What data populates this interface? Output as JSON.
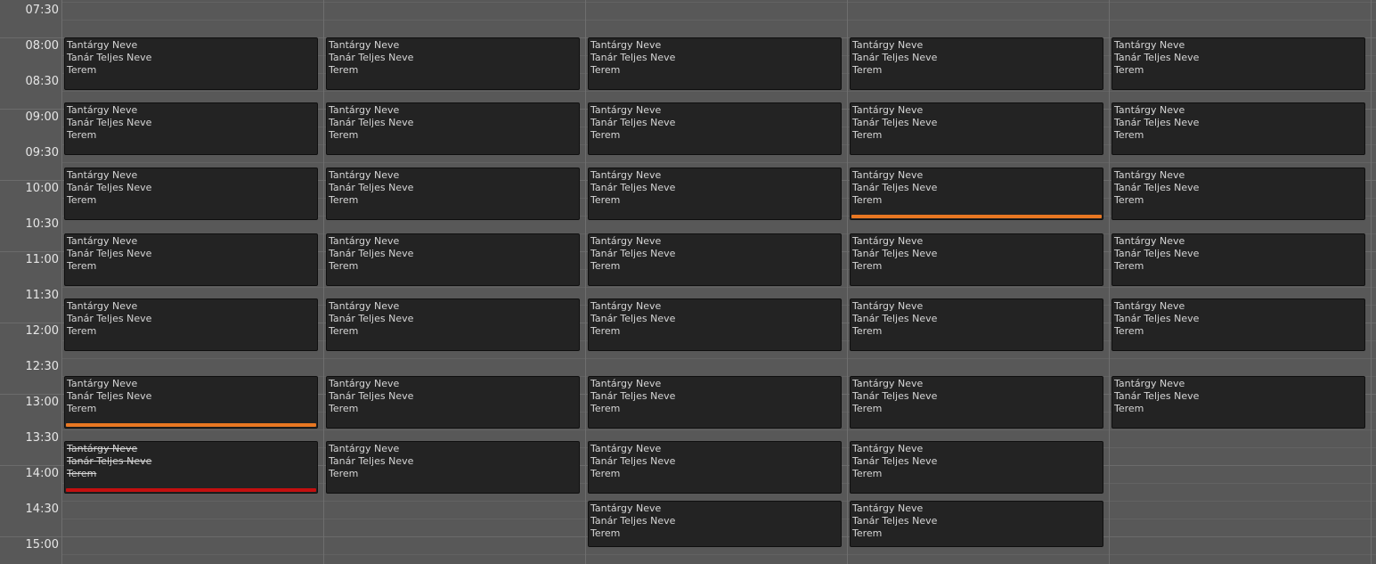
{
  "colors": {
    "background": "#585858",
    "lesson_background": "#232323",
    "lesson_text": "#d6d6d6",
    "status_changed": "#e87722",
    "status_cancelled": "#c40f0f"
  },
  "time_labels": [
    "07:30",
    "08:00",
    "08:30",
    "09:00",
    "09:30",
    "10:00",
    "10:30",
    "11:00",
    "11:30",
    "12:00",
    "12:30",
    "13:00",
    "13:30",
    "14:00",
    "14:30",
    "15:00"
  ],
  "days": [
    {
      "lessons": [
        {
          "subject": "Tantárgy Neve",
          "teacher": "Tanár Teljes Neve",
          "room": "Terem",
          "status": "normal"
        },
        {
          "subject": "Tantárgy Neve",
          "teacher": "Tanár Teljes Neve",
          "room": "Terem",
          "status": "normal"
        },
        {
          "subject": "Tantárgy Neve",
          "teacher": "Tanár Teljes Neve",
          "room": "Terem",
          "status": "normal"
        },
        {
          "subject": "Tantárgy Neve",
          "teacher": "Tanár Teljes Neve",
          "room": "Terem",
          "status": "normal"
        },
        {
          "subject": "Tantárgy Neve",
          "teacher": "Tanár Teljes Neve",
          "room": "Terem",
          "status": "normal"
        },
        {
          "subject": "Tantárgy Neve",
          "teacher": "Tanár Teljes Neve",
          "room": "Terem",
          "status": "changed"
        },
        {
          "subject": "Tantárgy Neve",
          "teacher": "Tanár Teljes Neve",
          "room": "Terem",
          "status": "cancelled"
        }
      ]
    },
    {
      "lessons": [
        {
          "subject": "Tantárgy Neve",
          "teacher": "Tanár Teljes Neve",
          "room": "Terem",
          "status": "normal"
        },
        {
          "subject": "Tantárgy Neve",
          "teacher": "Tanár Teljes Neve",
          "room": "Terem",
          "status": "normal"
        },
        {
          "subject": "Tantárgy Neve",
          "teacher": "Tanár Teljes Neve",
          "room": "Terem",
          "status": "normal"
        },
        {
          "subject": "Tantárgy Neve",
          "teacher": "Tanár Teljes Neve",
          "room": "Terem",
          "status": "normal"
        },
        {
          "subject": "Tantárgy Neve",
          "teacher": "Tanár Teljes Neve",
          "room": "Terem",
          "status": "normal"
        },
        {
          "subject": "Tantárgy Neve",
          "teacher": "Tanár Teljes Neve",
          "room": "Terem",
          "status": "normal"
        },
        {
          "subject": "Tantárgy Neve",
          "teacher": "Tanár Teljes Neve",
          "room": "Terem",
          "status": "normal"
        }
      ]
    },
    {
      "lessons": [
        {
          "subject": "Tantárgy Neve",
          "teacher": "Tanár Teljes Neve",
          "room": "Terem",
          "status": "normal"
        },
        {
          "subject": "Tantárgy Neve",
          "teacher": "Tanár Teljes Neve",
          "room": "Terem",
          "status": "normal"
        },
        {
          "subject": "Tantárgy Neve",
          "teacher": "Tanár Teljes Neve",
          "room": "Terem",
          "status": "normal"
        },
        {
          "subject": "Tantárgy Neve",
          "teacher": "Tanár Teljes Neve",
          "room": "Terem",
          "status": "normal"
        },
        {
          "subject": "Tantárgy Neve",
          "teacher": "Tanár Teljes Neve",
          "room": "Terem",
          "status": "normal"
        },
        {
          "subject": "Tantárgy Neve",
          "teacher": "Tanár Teljes Neve",
          "room": "Terem",
          "status": "normal"
        },
        {
          "subject": "Tantárgy Neve",
          "teacher": "Tanár Teljes Neve",
          "room": "Terem",
          "status": "normal"
        },
        {
          "subject": "Tantárgy Neve",
          "teacher": "Tanár Teljes Neve",
          "room": "Terem",
          "status": "normal"
        }
      ]
    },
    {
      "lessons": [
        {
          "subject": "Tantárgy Neve",
          "teacher": "Tanár Teljes Neve",
          "room": "Terem",
          "status": "normal"
        },
        {
          "subject": "Tantárgy Neve",
          "teacher": "Tanár Teljes Neve",
          "room": "Terem",
          "status": "normal"
        },
        {
          "subject": "Tantárgy Neve",
          "teacher": "Tanár Teljes Neve",
          "room": "Terem",
          "status": "changed"
        },
        {
          "subject": "Tantárgy Neve",
          "teacher": "Tanár Teljes Neve",
          "room": "Terem",
          "status": "normal"
        },
        {
          "subject": "Tantárgy Neve",
          "teacher": "Tanár Teljes Neve",
          "room": "Terem",
          "status": "normal"
        },
        {
          "subject": "Tantárgy Neve",
          "teacher": "Tanár Teljes Neve",
          "room": "Terem",
          "status": "normal"
        },
        {
          "subject": "Tantárgy Neve",
          "teacher": "Tanár Teljes Neve",
          "room": "Terem",
          "status": "normal"
        },
        {
          "subject": "Tantárgy Neve",
          "teacher": "Tanár Teljes Neve",
          "room": "Terem",
          "status": "normal"
        }
      ]
    },
    {
      "lessons": [
        {
          "subject": "Tantárgy Neve",
          "teacher": "Tanár Teljes Neve",
          "room": "Terem",
          "status": "normal"
        },
        {
          "subject": "Tantárgy Neve",
          "teacher": "Tanár Teljes Neve",
          "room": "Terem",
          "status": "normal"
        },
        {
          "subject": "Tantárgy Neve",
          "teacher": "Tanár Teljes Neve",
          "room": "Terem",
          "status": "normal"
        },
        {
          "subject": "Tantárgy Neve",
          "teacher": "Tanár Teljes Neve",
          "room": "Terem",
          "status": "normal"
        },
        {
          "subject": "Tantárgy Neve",
          "teacher": "Tanár Teljes Neve",
          "room": "Terem",
          "status": "normal"
        },
        {
          "subject": "Tantárgy Neve",
          "teacher": "Tanár Teljes Neve",
          "room": "Terem",
          "status": "normal"
        }
      ]
    }
  ]
}
